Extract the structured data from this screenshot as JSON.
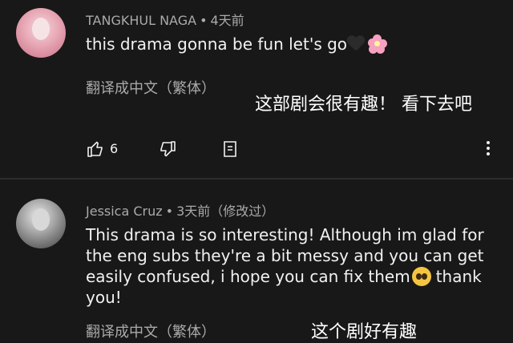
{
  "comments": [
    {
      "author": "TANGKHUL NAGA",
      "separator": "•",
      "time": "4天前",
      "edited": "",
      "text": "this drama gonna be fun let's go",
      "translate_link": "翻译成中文（繁体）",
      "overlay_translation": "这部剧会很有趣！ 看下去吧",
      "like_count": "6"
    },
    {
      "author": "Jessica Cruz",
      "separator": "•",
      "time": "3天前",
      "edited": "（修改过）",
      "text_before_emoji": "This drama is so interesting! Although im glad for the eng subs they're a bit messy and you can get easily confused, i hope you can fix them",
      "text_after_emoji": "thank you!",
      "translate_link": "翻译成中文（繁体）",
      "overlay_translation": "这个剧好有趣"
    }
  ],
  "icons": {
    "like": "thumbs-up-icon",
    "dislike": "thumbs-down-icon",
    "reply": "reply-icon",
    "more": "more-vert-icon"
  },
  "colors": {
    "background": "#181818",
    "primary_text": "#f1f1f1",
    "secondary_text": "#aaaaaa"
  }
}
